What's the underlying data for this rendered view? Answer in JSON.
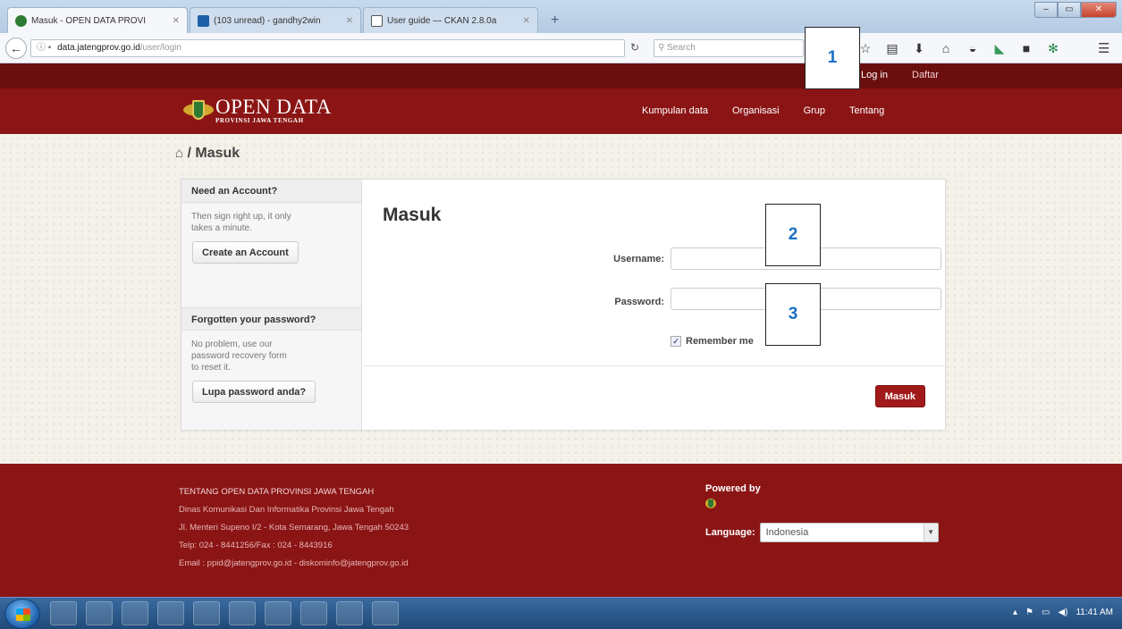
{
  "browser": {
    "tabs": [
      {
        "title": "Masuk - OPEN DATA PROVI",
        "active": true,
        "favicon_color": "#2f7a33"
      },
      {
        "title": "(103 unread) - gandhy2win",
        "active": false,
        "favicon_color": "#1b5fa8"
      },
      {
        "title": "User guide — CKAN 2.8.0a",
        "active": false,
        "favicon_color": "#555555"
      }
    ],
    "new_tab_label": "+",
    "window_controls": {
      "minimize": "–",
      "maximize": "▭",
      "close": "✕"
    },
    "url": {
      "host": "data.jatengprov.go.id",
      "path": "/user/login"
    },
    "search_placeholder": "Search",
    "toolbar_icons": [
      "star-icon",
      "reading-list-icon",
      "download-icon",
      "home-icon",
      "pocket-icon",
      "sync-icon",
      "black-square-icon",
      "extension-icon"
    ],
    "menu_icon": "hamburger-menu-icon"
  },
  "account": {
    "login": "Log in",
    "register": "Daftar"
  },
  "site": {
    "logo_title": "OPEN DATA",
    "logo_subtitle": "PROVINSI JAWA TENGAH",
    "nav": [
      "Kumpulan data",
      "Organisasi",
      "Grup",
      "Tentang"
    ]
  },
  "breadcrumb": {
    "home_icon": "⌂",
    "current": "/ Masuk"
  },
  "sidebar": {
    "account_heading": "Need an Account?",
    "account_text": "Then sign right up, it only takes a minute.",
    "create_button": "Create an Account",
    "forgot_heading": "Forgotten your password?",
    "forgot_text": "No problem, use our password recovery form to reset it.",
    "forgot_button": "Lupa password anda?"
  },
  "form": {
    "title": "Masuk",
    "username_label": "Username:",
    "username_value": "",
    "password_label": "Password:",
    "password_value": "",
    "remember_label": "Remember me",
    "remember_checked": true,
    "submit_label": "Masuk"
  },
  "callouts": [
    "1",
    "2",
    "3"
  ],
  "footer": {
    "lines": [
      "TENTANG OPEN DATA PROVINSI JAWA TENGAH",
      "Dinas Komunikasi Dan Informatika Provinsi Jawa Tengah",
      "Jl. Menteri Supeno I/2 - Kota Semarang, Jawa Tengah 50243",
      "Telp: 024 - 8441256/Fax : 024 - 8443916",
      "Email : ppid@jatengprov.go.id - diskominfo@jatengprov.go.id"
    ],
    "powered_by": "Powered by",
    "language_label": "Language:",
    "language_value": "Indonesia"
  },
  "taskbar": {
    "clock": "11:41 AM"
  }
}
